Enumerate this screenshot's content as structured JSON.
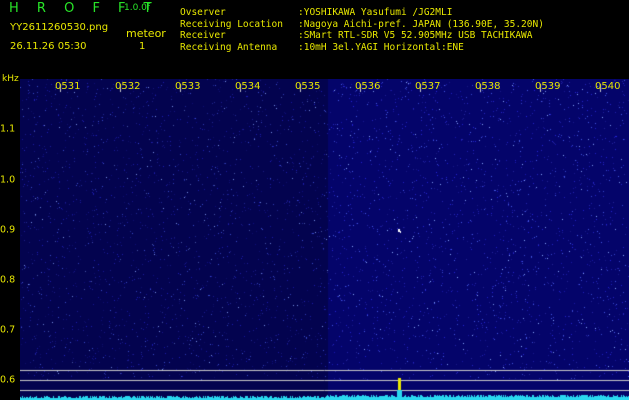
{
  "header": {
    "app_title": "H R O F F T",
    "version": "1.0.0f",
    "filename": "YY2611260530.png",
    "timestamp": "26.11.26 05:30",
    "meteor_label": "meteor",
    "meteor_count": "1"
  },
  "info": {
    "observer_label": "Ovserver",
    "observer_value": ":YOSHIKAWA Yasufumi /JG2MLI",
    "location_label": "Receiving Location",
    "location_value": ":Nagoya Aichi-pref. JAPAN (136.90E, 35.20N)",
    "receiver_label": "Receiver",
    "receiver_value": ":SMart RTL-SDR V5 52.905MHz USB TACHIKAWA",
    "antenna_label": "Receiving Antenna",
    "antenna_value": ":10mH 3el.YAGI Horizontal:ENE"
  },
  "axis": {
    "unit": "kHz",
    "y_ticks": [
      "1.1",
      "1.0",
      "0.9",
      "0.8",
      "0.7",
      "0.6"
    ],
    "x_ticks": [
      "0531",
      "0532",
      "0533",
      "0534",
      "0535",
      "0536",
      "0537",
      "0538",
      "0539",
      "0540"
    ]
  },
  "colors": {
    "text_green": "#28e428",
    "text_yellow": "#e8e800",
    "background": "#000000",
    "waterfall": "#04046a",
    "trace": "#2ad8f0"
  }
}
